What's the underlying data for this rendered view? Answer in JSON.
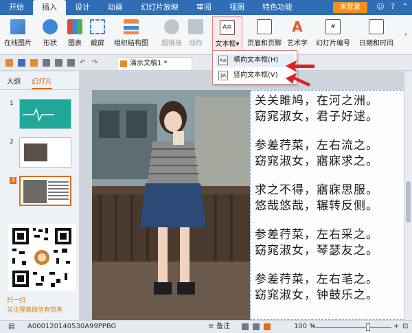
{
  "menubar": {
    "tabs": [
      "开始",
      "插入",
      "设计",
      "动画",
      "幻灯片放映",
      "审阅",
      "视图",
      "特色功能"
    ],
    "active_tab": "插入",
    "login_label": "未登录",
    "colors": {
      "bar": "#2f6db5",
      "login": "#f39019"
    }
  },
  "ribbon": {
    "buttons": [
      {
        "label": "在线图片",
        "icon": "online-picture-icon"
      },
      {
        "label": "形状",
        "icon": "shapes-icon"
      },
      {
        "label": "图表",
        "icon": "chart-icon"
      },
      {
        "label": "截屏",
        "icon": "screenshot-icon"
      },
      {
        "label": "组织结构图",
        "icon": "org-chart-icon"
      },
      {
        "label": "超链接",
        "icon": "hyperlink-icon",
        "disabled": true
      },
      {
        "label": "动作",
        "icon": "action-icon",
        "disabled": true
      },
      {
        "label": "文本框",
        "icon": "textbox-icon",
        "highlighted": true
      },
      {
        "label": "页眉和页脚",
        "icon": "header-footer-icon"
      },
      {
        "label": "艺术字",
        "icon": "wordart-icon"
      },
      {
        "label": "幻灯片编号",
        "icon": "slide-number-icon"
      },
      {
        "label": "日期和时间",
        "icon": "date-time-icon"
      }
    ]
  },
  "dropdown": {
    "items": [
      {
        "label": "横向文本框(H)",
        "icon": "horizontal-textbox-icon"
      },
      {
        "label": "竖向文本框(V)",
        "icon": "vertical-textbox-icon"
      }
    ]
  },
  "document": {
    "tab_title": "演示文稿1 *"
  },
  "leftpanel": {
    "tabs": [
      "大纲",
      "幻灯片"
    ],
    "active_tab": "幻灯片",
    "slides": [
      "1",
      "2",
      "3"
    ],
    "active_slide": "3",
    "qr_caption_1": "扫一扫",
    "qr_caption_2": "关注狸窝微信有惊喜"
  },
  "slide": {
    "poem": [
      [
        "关关雎鸠，在河之洲。",
        "窈窕淑女，君子好逑。"
      ],
      [
        "参差荇菜，左右流之。",
        "窈窕淑女，寤寐求之。"
      ],
      [
        "求之不得，寤寐思服。",
        "悠哉悠哉，辗转反侧。"
      ],
      [
        "参差荇菜，左右采之。",
        "窈窕淑女，琴瑟友之。"
      ],
      [
        "参差荇菜，左右芼之。",
        "窈窕淑女，钟鼓乐之。"
      ]
    ]
  },
  "statusbar": {
    "left_text": "A000120140530A99PPBG",
    "notes_label": "备注",
    "zoom": "100 %"
  }
}
